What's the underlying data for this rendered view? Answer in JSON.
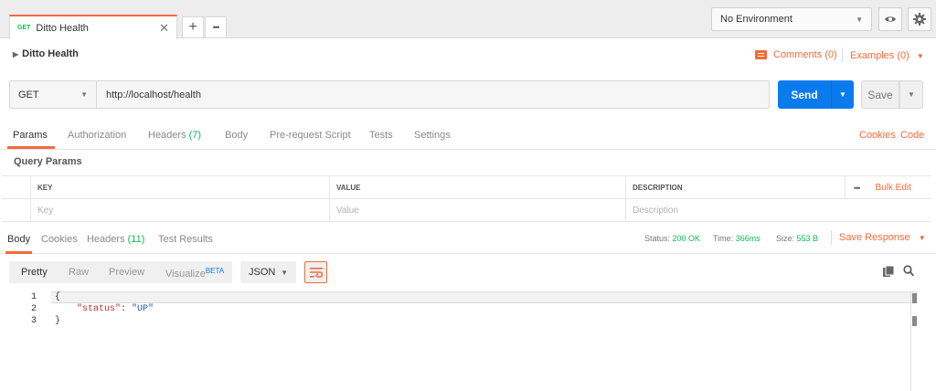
{
  "tab": {
    "method_badge": "GET",
    "name": "Ditto Health",
    "close": "✕"
  },
  "tab_actions": {
    "add": "+",
    "more": "•••"
  },
  "environment": {
    "selected": "No Environment"
  },
  "request": {
    "collection_name": "Ditto Health",
    "comments": "Comments (0)",
    "examples": "Examples (0)",
    "method": "GET",
    "url": "http://localhost/health",
    "send_label": "Send",
    "save_label": "Save"
  },
  "request_tabs": {
    "params": "Params",
    "authorization": "Authorization",
    "headers": "Headers",
    "headers_count": "(7)",
    "body": "Body",
    "prerequest": "Pre-request Script",
    "tests": "Tests",
    "settings": "Settings",
    "cookies": "Cookies",
    "code": "Code"
  },
  "query_params": {
    "title": "Query Params",
    "columns": {
      "key": "KEY",
      "value": "VALUE",
      "description": "DESCRIPTION"
    },
    "more": "•••",
    "bulk_edit": "Bulk Edit",
    "placeholders": {
      "key": "Key",
      "value": "Value",
      "description": "Description"
    }
  },
  "response_tabs": {
    "body": "Body",
    "cookies": "Cookies",
    "headers": "Headers",
    "headers_count": "(11)",
    "test_results": "Test Results"
  },
  "response_status": {
    "status_label": "Status:",
    "status_value": "200 OK",
    "time_label": "Time:",
    "time_value": "366ms",
    "size_label": "Size:",
    "size_value": "553 B",
    "save_response": "Save Response"
  },
  "body_view": {
    "pretty": "Pretty",
    "raw": "Raw",
    "preview": "Preview",
    "visualize": "Visualize",
    "beta": "BETA",
    "format": "JSON"
  },
  "code": {
    "line_numbers": [
      "1",
      "2",
      "3"
    ],
    "open_brace": "{",
    "key": "\"status\"",
    "colon": ": ",
    "value": "\"UP\"",
    "close_brace": "}"
  },
  "colors": {
    "accent": "#f26b3a",
    "send_blue": "#097bed",
    "success_green": "#0cbb52"
  }
}
